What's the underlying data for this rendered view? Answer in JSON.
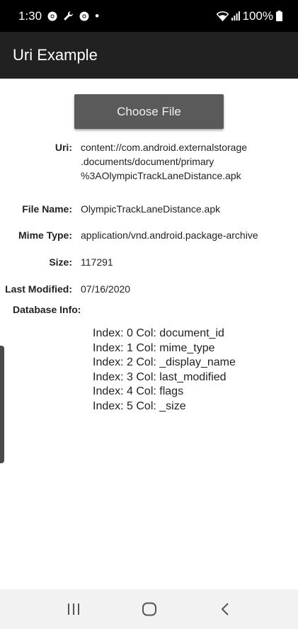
{
  "status_bar": {
    "time": "1:30",
    "dot": "•",
    "battery_text": "100%",
    "icons_left": [
      "chrome-icon",
      "wrench-icon",
      "chrome-icon"
    ],
    "icons_right": [
      "wifi-icon",
      "signal-icon",
      "battery-icon"
    ]
  },
  "app_bar": {
    "title": "Uri Example"
  },
  "choose_button": {
    "label": "Choose File"
  },
  "details": {
    "uri_label": "Uri:",
    "uri_value": "content://com.android.externalstorage\n.documents/document/primary\n%3AOlympicTrackLaneDistance.apk",
    "file_name_label": "File Name:",
    "file_name_value": "OlympicTrackLaneDistance.apk",
    "mime_label": "Mime Type:",
    "mime_value": "application/vnd.android.package-archive",
    "size_label": "Size:",
    "size_value": "117291",
    "modified_label": "Last Modified:",
    "modified_value": "07/16/2020"
  },
  "database": {
    "label": "Database Info:",
    "columns": [
      "Index: 0 Col: document_id",
      "Index: 1 Col: mime_type",
      "Index: 2 Col: _display_name",
      "Index: 3 Col: last_modified",
      "Index: 4 Col: flags",
      "Index: 5 Col: _size"
    ]
  },
  "colors": {
    "status_bar": "#000000",
    "app_bar": "#212121",
    "button": "#5a5a5a",
    "nav_bar": "#f2f2f2"
  }
}
